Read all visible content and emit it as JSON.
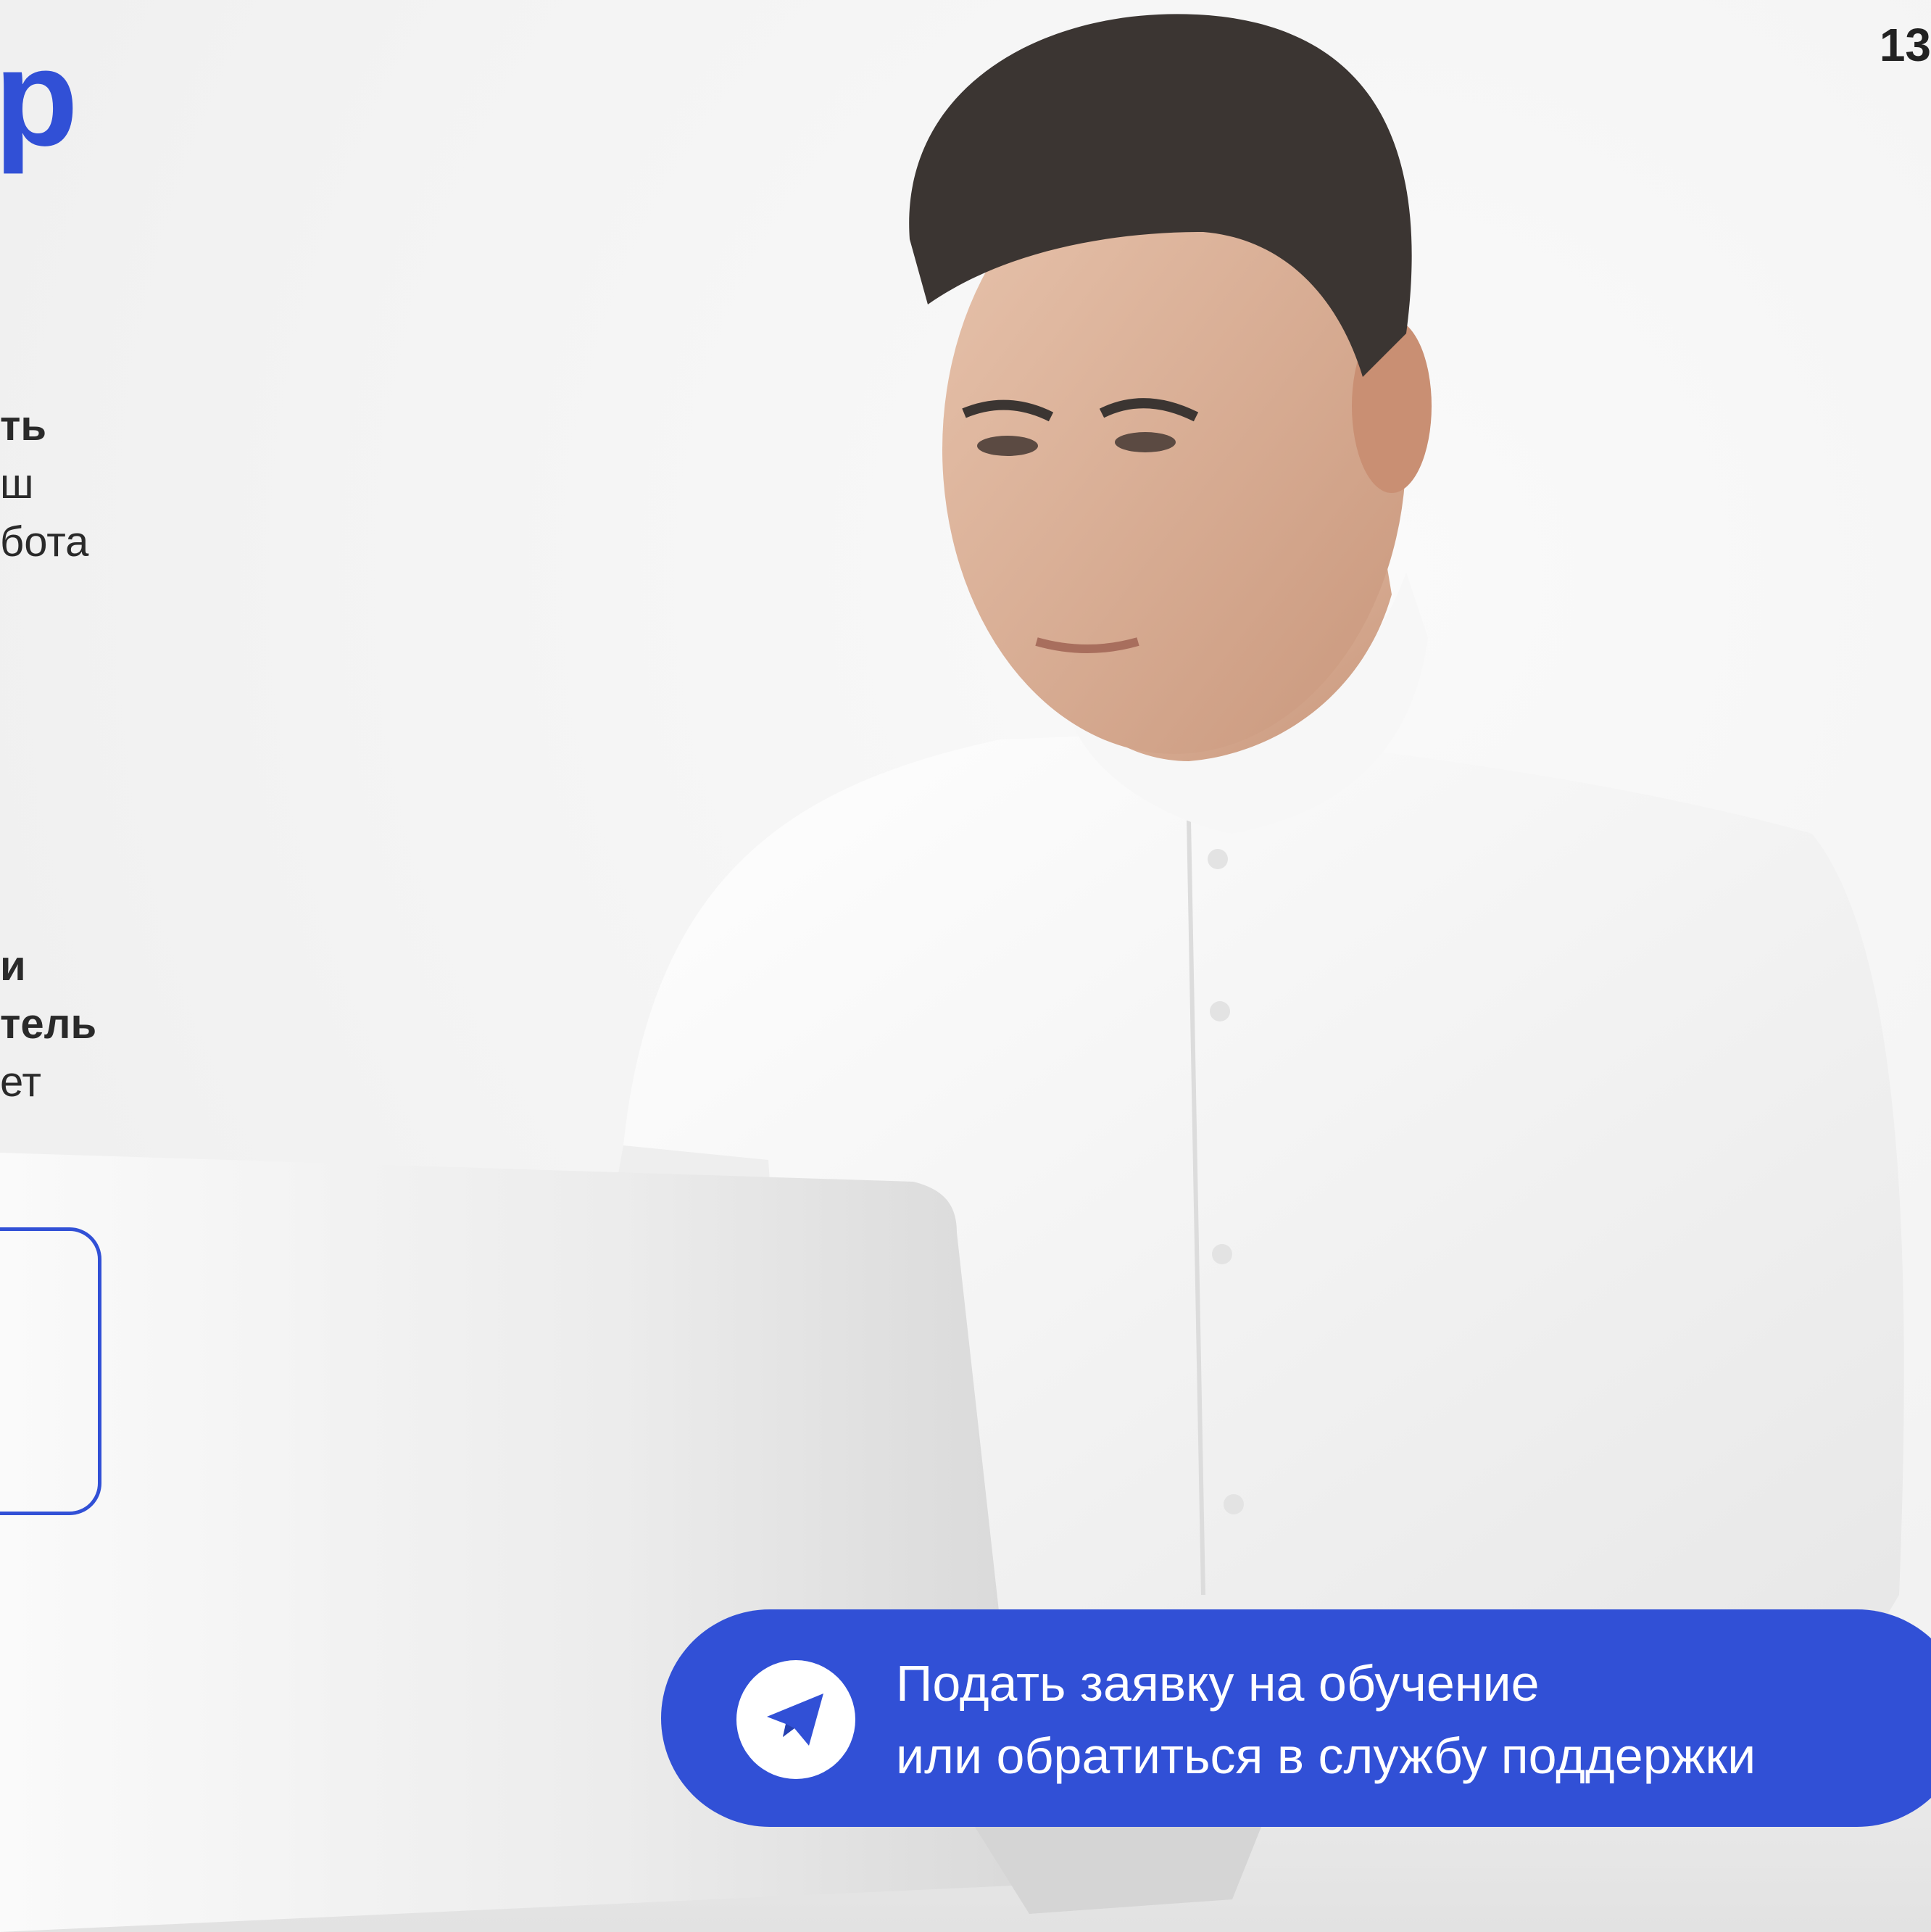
{
  "slide": {
    "page_number": "13",
    "title_fragment": "р"
  },
  "text_block_1": {
    "line1": "ть",
    "line2": "ш",
    "line3": "бота"
  },
  "text_block_2": {
    "line1": "и",
    "line2": "тель",
    "line3": "ет"
  },
  "cta": {
    "icon": "telegram-icon",
    "line1": "Подать заявку на обучение",
    "line2": "или обратиться в службу поддержки"
  },
  "colors": {
    "accent": "#3150d6",
    "text": "#2a2a2a",
    "background": "#f4f4f4"
  }
}
